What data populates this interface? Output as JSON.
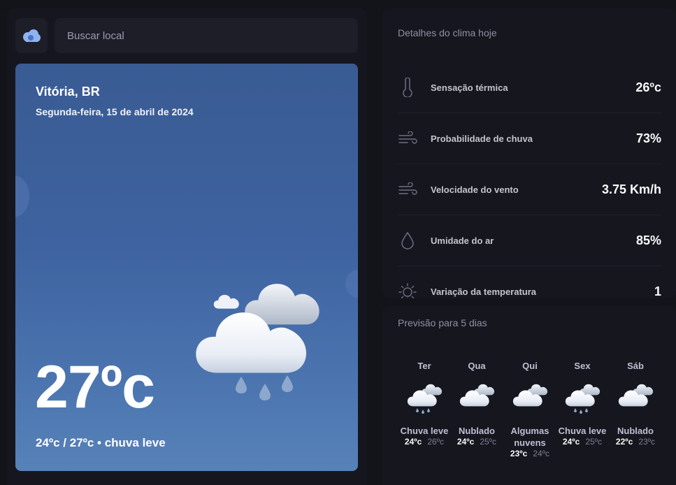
{
  "search": {
    "placeholder": "Buscar local"
  },
  "hero": {
    "city": "Vitória, BR",
    "date": "Segunda-feira, 15 de abril de 2024",
    "temperature": "27ºc",
    "summary": "24ºc / 27ºc • chuva leve",
    "icon": "rain-cloud-icon"
  },
  "details": {
    "title": "Detalhes do clima hoje",
    "items": [
      {
        "label": "Sensação térmica",
        "value": "26ºc",
        "icon": "thermometer-icon"
      },
      {
        "label": "Probabilidade de chuva",
        "value": "73%",
        "icon": "wind-icon"
      },
      {
        "label": "Velocidade do vento",
        "value": "3.75 Km/h",
        "icon": "wind-icon"
      },
      {
        "label": "Umidade do ar",
        "value": "85%",
        "icon": "drop-icon"
      },
      {
        "label": "Variação da temperatura",
        "value": "1",
        "icon": "sun-icon"
      }
    ]
  },
  "forecast": {
    "title": "Previsão para 5 dias",
    "days": [
      {
        "name": "Ter",
        "desc": "Chuva leve",
        "max": "24ºc",
        "min": "26ºc",
        "icon": "rain-cloud-icon"
      },
      {
        "name": "Qua",
        "desc": "Nublado",
        "max": "24ºc",
        "min": "25ºc",
        "icon": "cloud-icon"
      },
      {
        "name": "Qui",
        "desc": "Algumas nuvens",
        "max": "23ºc",
        "min": "24ºc",
        "icon": "cloud-icon"
      },
      {
        "name": "Sex",
        "desc": "Chuva leve",
        "max": "24ºc",
        "min": "25ºc",
        "icon": "rain-cloud-icon"
      },
      {
        "name": "Sáb",
        "desc": "Nublado",
        "max": "22ºc",
        "min": "23ºc",
        "icon": "cloud-icon"
      }
    ]
  },
  "colors": {
    "background": "#13131a",
    "panel": "#16161f",
    "hero_top": "#3a5b93",
    "hero_bottom": "#5782b8"
  }
}
